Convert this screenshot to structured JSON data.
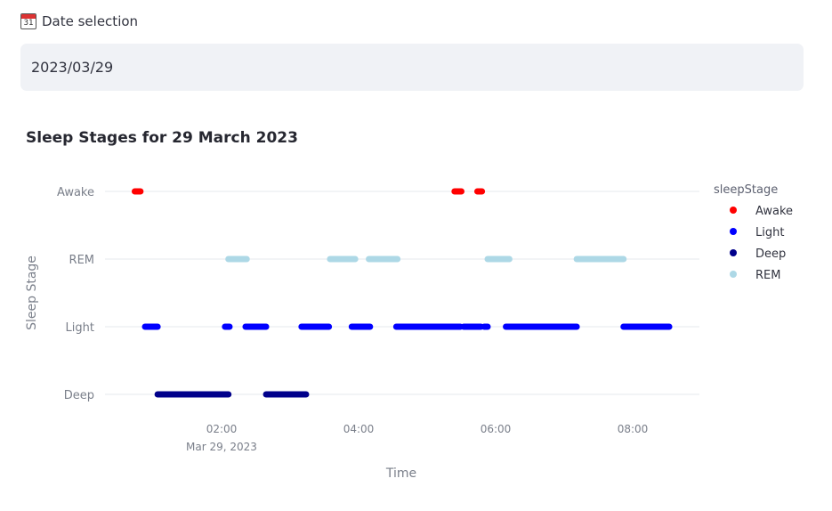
{
  "date_selection": {
    "label": "Date selection",
    "icon": "calendar-icon",
    "icon_text": "31",
    "value": "2023/03/29"
  },
  "chart_data": {
    "type": "scatter",
    "title": "Sleep Stages for 29 March 2023",
    "xlabel": "Time",
    "ylabel": "Sleep Stage",
    "categories_y": [
      "Deep",
      "Light",
      "REM",
      "Awake"
    ],
    "x_ticks": [
      "02:00",
      "04:00",
      "06:00",
      "08:00"
    ],
    "x_tick_sublabel": "Mar 29, 2023",
    "xlim": [
      "2023-03-29 00:25",
      "2023-03-29 09:13"
    ],
    "grid": true,
    "legend": {
      "title": "sleepStage",
      "position": "right",
      "entries": [
        "Awake",
        "Light",
        "Deep",
        "REM"
      ]
    },
    "series": [
      {
        "name": "Awake",
        "color": "#ff0000",
        "segments": [
          [
            "00:44",
            "00:49"
          ],
          [
            "05:24",
            "05:30"
          ],
          [
            "05:44",
            "05:48"
          ]
        ]
      },
      {
        "name": "REM",
        "color": "#add8e6",
        "segments": [
          [
            "02:06",
            "02:22"
          ],
          [
            "03:35",
            "03:57"
          ],
          [
            "04:09",
            "04:34"
          ],
          [
            "05:53",
            "06:12"
          ],
          [
            "07:11",
            "07:52"
          ]
        ]
      },
      {
        "name": "Light",
        "color": "#0000ff",
        "segments": [
          [
            "00:53",
            "01:04"
          ],
          [
            "02:03",
            "02:07"
          ],
          [
            "02:21",
            "02:39"
          ],
          [
            "03:10",
            "03:34"
          ],
          [
            "03:54",
            "04:10"
          ],
          [
            "04:33",
            "05:29"
          ],
          [
            "05:32",
            "05:47"
          ],
          [
            "05:50",
            "05:53"
          ],
          [
            "06:09",
            "07:11"
          ],
          [
            "07:52",
            "08:32"
          ]
        ]
      },
      {
        "name": "Deep",
        "color": "#00008b",
        "segments": [
          [
            "01:04",
            "02:06"
          ],
          [
            "02:39",
            "03:14"
          ]
        ]
      }
    ]
  }
}
